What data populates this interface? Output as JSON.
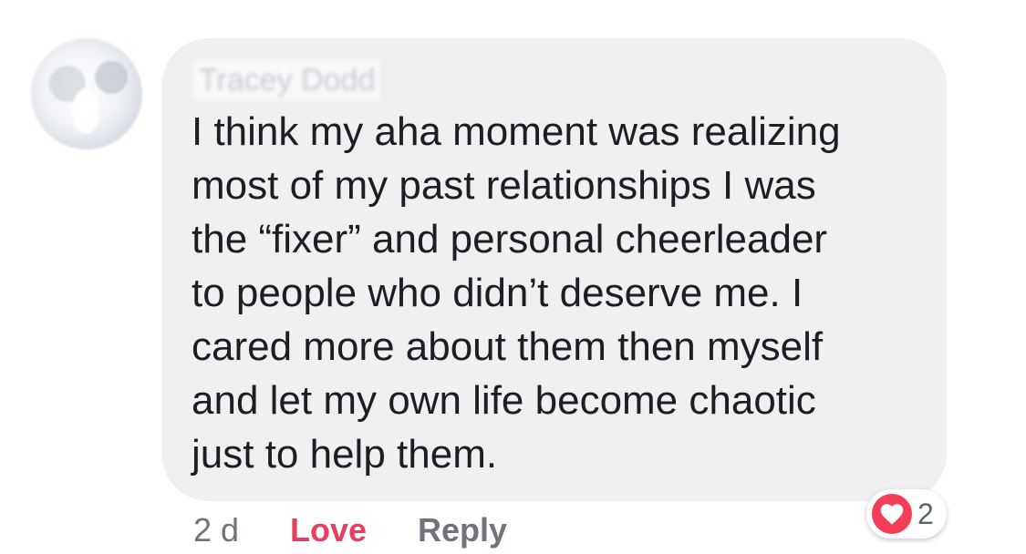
{
  "comment": {
    "author_name": "Tracey Dodd",
    "avatar_icon": "profile-photo-avatar",
    "text_lines": [
      "I think my aha moment was realizing",
      "most of my past relationships I was",
      "the “fixer” and personal cheerleader",
      "to people who didn’t deserve me. I",
      "cared more about them then myself",
      "and let my own life become chaotic",
      "just to help them."
    ],
    "timestamp": "2 d",
    "love_label": "Love",
    "reply_label": "Reply",
    "reaction": {
      "icon": "heart-icon",
      "count": "2",
      "color": "#f33e58"
    }
  },
  "colors": {
    "bubble_background": "#eff0f2",
    "text": "#1c1e21",
    "meta_text": "#707379",
    "love_active": "#e4405f"
  }
}
